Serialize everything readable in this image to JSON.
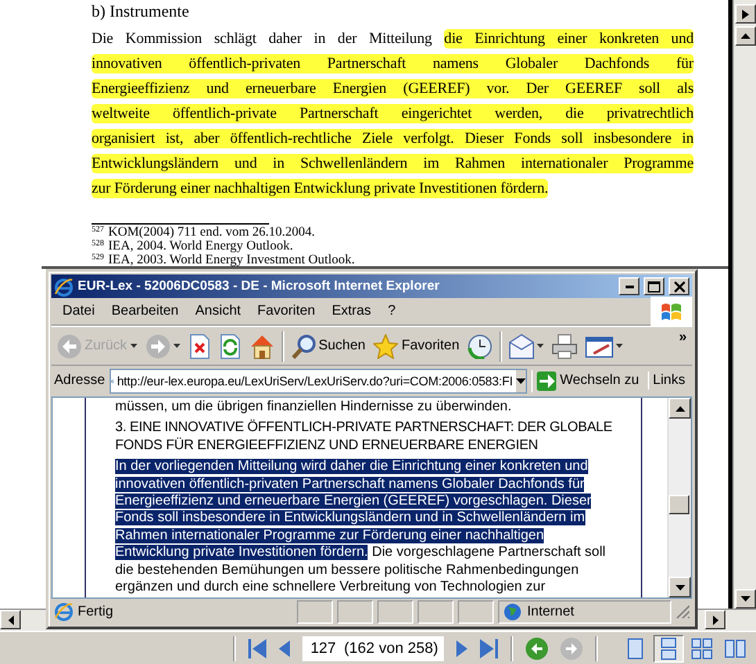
{
  "pdf_page": {
    "heading": "b) Instrumente",
    "lines": [
      {
        "text": "Die Kommission schlägt daher in der Mitteilung ",
        "highlighted": "die Einrichtung einer konkreten und"
      },
      {
        "highlighted": "innovativen öffentlich-privaten Partnerschaft namens Globaler Dachfonds für"
      },
      {
        "highlighted": "Energieeffizienz und erneuerbare Energien (GEEREF) vor. Der GEEREF soll als"
      },
      {
        "highlighted": "weltweite öffentlich-private Partnerschaft eingerichtet werden, die privatrechtlich"
      },
      {
        "highlighted": "organisiert ist, aber öffentlich-rechtliche Ziele verfolgt. Dieser Fonds soll insbesondere in"
      },
      {
        "highlighted": "Entwicklungsländern und in Schwellenländern im Rahmen internationaler Programme"
      },
      {
        "highlighted": "zur Förderung einer nachhaltigen Entwicklung private Investitionen fördern."
      }
    ],
    "footnotes": [
      {
        "mark": "527",
        "text": "KOM(2004) 711 end. vom 26.10.2004."
      },
      {
        "mark": "528",
        "text": "IEA, 2004. World Energy Outlook."
      },
      {
        "mark": "529",
        "text": "IEA, 2003. World Energy Investment Outlook."
      }
    ]
  },
  "browser": {
    "title": "EUR-Lex - 52006DC0583 - DE - Microsoft Internet Explorer",
    "menu": [
      "Datei",
      "Bearbeiten",
      "Ansicht",
      "Favoriten",
      "Extras",
      "?"
    ],
    "toolbar": [
      {
        "kind": "back",
        "label": "Zurück",
        "disabled": true
      },
      {
        "kind": "forward",
        "disabled": true
      },
      {
        "kind": "stop"
      },
      {
        "kind": "refresh"
      },
      {
        "kind": "home"
      },
      {
        "kind": "search",
        "label": "Suchen"
      },
      {
        "kind": "favorites",
        "label": "Favoriten"
      },
      {
        "kind": "history"
      },
      {
        "kind": "mail"
      },
      {
        "kind": "print"
      },
      {
        "kind": "edit"
      },
      {
        "kind": "more",
        "label": "»"
      }
    ],
    "address_label": "Adresse",
    "url": "http://eur-lex.europa.eu/LexUriServ/LexUriServ.do?uri=COM:2006:0583:FI",
    "go_label": "Wechseln zu",
    "links_label": "Links",
    "document": [
      {
        "kind": "text",
        "lines": [
          {
            "text": "müssen, um die übrigen finanziellen Hindernisse zu überwinden."
          }
        ]
      },
      {
        "kind": "heading",
        "lines": [
          {
            "text": "3. EINE INNOVATIVE ÖFFENTLICH-PRIVATE PARTNERSCHAFT: DER GLOBALE"
          },
          {
            "text": "FONDS FÜR ENERGIEEFFIZIENZ UND ERNEUERBARE ENERGIEN"
          }
        ]
      },
      {
        "kind": "text",
        "lines": [
          {
            "selected": "In der vorliegenden Mitteilung wird daher die Einrichtung einer konkreten und"
          },
          {
            "selected": "innovativen öffentlich-privaten Partnerschaft namens Globaler Dachfonds für"
          },
          {
            "selected": "Energieeffizienz und erneuerbare Energien (GEEREF) vorgeschlagen. Dieser"
          },
          {
            "selected": "Fonds soll insbesondere in Entwicklungsländern und in Schwellenländern im"
          },
          {
            "selected": "Rahmen internationaler Programme zur Förderung einer nachhaltigen"
          },
          {
            "selected": "Entwicklung private Investitionen fördern.",
            "text": " Die vorgeschlagene Partnerschaft soll"
          },
          {
            "text": "die bestehenden Bemühungen um bessere politische Rahmenbedingungen"
          },
          {
            "text": "ergänzen und durch eine schnellere Verbreitung von Technologien zur"
          }
        ]
      }
    ],
    "status": "Fertig",
    "zone": "Internet"
  },
  "pdf_toolbar": {
    "page": "127",
    "page_count": "(162 von 258)",
    "nav": [
      {
        "kind": "first"
      },
      {
        "kind": "prev"
      },
      {
        "kind": "next"
      },
      {
        "kind": "last"
      },
      {
        "kind": "back"
      },
      {
        "kind": "forward",
        "disabled": true
      }
    ],
    "layouts": [
      {
        "kind": "single",
        "selected": false
      },
      {
        "kind": "continuous",
        "selected": true
      },
      {
        "kind": "facing",
        "selected": false
      },
      {
        "kind": "facing-continuous",
        "selected": false
      }
    ]
  }
}
